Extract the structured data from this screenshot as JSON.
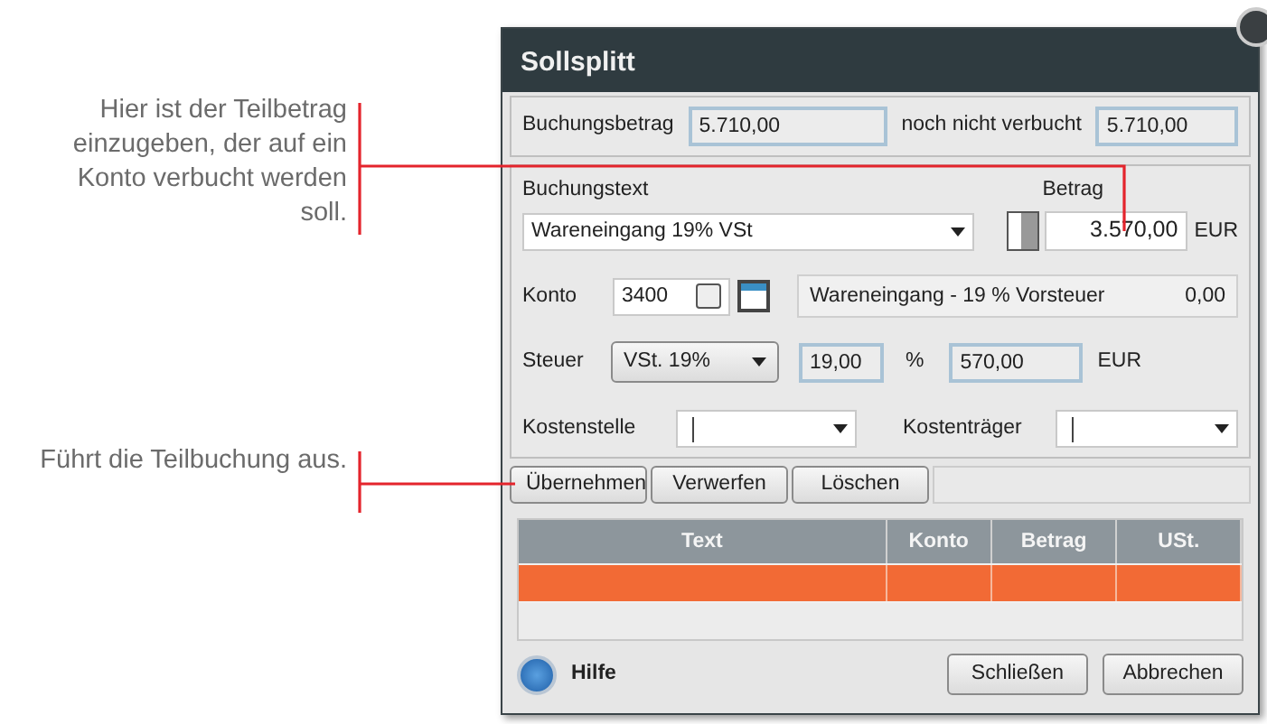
{
  "callouts": [
    {
      "text": "Hier ist der Teilbetrag einzugeben, der auf ein Konto verbucht werden soll."
    },
    {
      "text": "Führt die Teilbuchung aus."
    }
  ],
  "dialog": {
    "title": "Sollsplitt",
    "summary": {
      "amount_label": "Buchungsbetrag",
      "amount": "5.710,00",
      "open_label": "noch nicht verbucht",
      "open": "5.710,00"
    },
    "booking_text": {
      "label": "Buchungstext",
      "value": "Wareneingang 19% VSt"
    },
    "amount": {
      "label": "Betrag",
      "value": "3.570,00",
      "currency": "EUR"
    },
    "account": {
      "label": "Konto",
      "value": "3400",
      "description": "Wareneingang - 19 % Vorsteuer",
      "balance": "0,00"
    },
    "tax": {
      "label": "Steuer",
      "value": "VSt. 19%",
      "rate": "19,00",
      "percent": "%",
      "tax_amount": "570,00",
      "currency": "EUR"
    },
    "cost_center": {
      "label": "Kostenstelle"
    },
    "cost_unit": {
      "label": "Kostenträger"
    },
    "actions": [
      "Übernehmen",
      "Verwerfen",
      "Löschen"
    ],
    "table": {
      "columns": [
        "Text",
        "Konto",
        "Betrag",
        "USt."
      ],
      "rows": [
        {
          "selected": true
        },
        {
          "selected": false
        }
      ]
    },
    "help": "Hilfe",
    "buttons": [
      "Schließen",
      "Abbrechen"
    ]
  }
}
